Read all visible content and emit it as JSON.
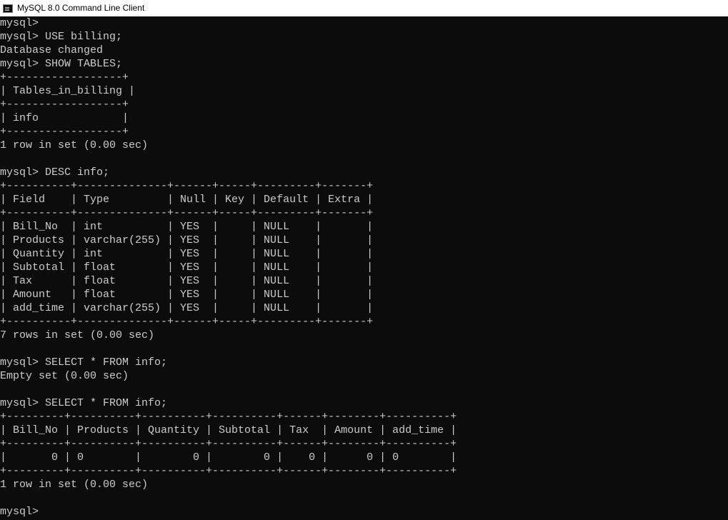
{
  "window": {
    "title": "MySQL 8.0 Command Line Client",
    "icon": "mysql-console-icon"
  },
  "colors": {
    "background": "#0c0c0c",
    "text": "#cccccc",
    "titlebar": "#ffffff"
  },
  "console": {
    "lines": [
      "mysql>",
      "mysql> USE billing;",
      "Database changed",
      "mysql> SHOW TABLES;",
      "+------------------+",
      "| Tables_in_billing |",
      "+------------------+",
      "| info             |",
      "+------------------+",
      "1 row in set (0.00 sec)",
      "",
      "mysql> DESC info;",
      "+----------+--------------+------+-----+---------+-------+",
      "| Field    | Type         | Null | Key | Default | Extra |",
      "+----------+--------------+------+-----+---------+-------+",
      "| Bill_No  | int          | YES  |     | NULL    |       |",
      "| Products | varchar(255) | YES  |     | NULL    |       |",
      "| Quantity | int          | YES  |     | NULL    |       |",
      "| Subtotal | float        | YES  |     | NULL    |       |",
      "| Tax      | float        | YES  |     | NULL    |       |",
      "| Amount   | float        | YES  |     | NULL    |       |",
      "| add_time | varchar(255) | YES  |     | NULL    |       |",
      "+----------+--------------+------+-----+---------+-------+",
      "7 rows in set (0.00 sec)",
      "",
      "mysql> SELECT * FROM info;",
      "Empty set (0.00 sec)",
      "",
      "mysql> SELECT * FROM info;",
      "+---------+----------+----------+----------+------+--------+----------+",
      "| Bill_No | Products | Quantity | Subtotal | Tax  | Amount | add_time |",
      "+---------+----------+----------+----------+------+--------+----------+",
      "|       0 | 0        |        0 |        0 |    0 |      0 | 0        |",
      "+---------+----------+----------+----------+------+--------+----------+",
      "1 row in set (0.00 sec)",
      "",
      "mysql>"
    ]
  }
}
